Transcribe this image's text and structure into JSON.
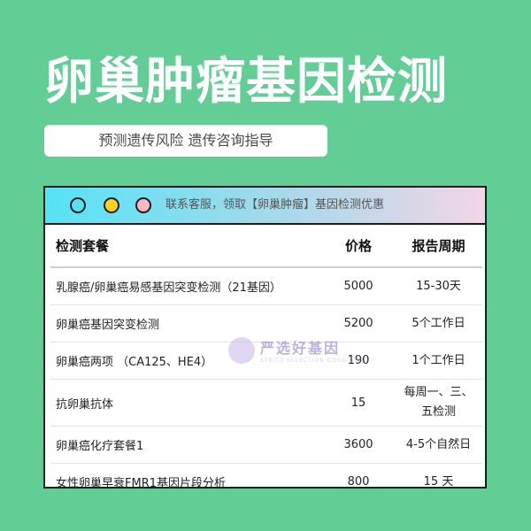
{
  "header": {
    "title": "卵巢肿瘤基因检测",
    "subtitle": "预测遗传风险 遗传咨询指导"
  },
  "window": {
    "bar_text": "联系客服，领取【卵巢肿瘤】基因检测优惠",
    "dots": [
      {
        "name": "blue-dot-icon",
        "color": "#59e0f0"
      },
      {
        "name": "yellow-dot-icon",
        "color": "#ffd21f"
      },
      {
        "name": "pink-dot-icon",
        "color": "#f8b8c2"
      }
    ]
  },
  "table": {
    "headers": [
      "检测套餐",
      "价格",
      "报告周期"
    ],
    "rows": [
      {
        "name": "乳腺癌/卵巢癌易感基因突变检测（21基因）",
        "price": "5000",
        "cycle": "15-30天"
      },
      {
        "name": "卵巢癌基因突变检测",
        "price": "5200",
        "cycle": "5个工作日"
      },
      {
        "name": "卵巢癌两项 （CA125、HE4）",
        "price": "190",
        "cycle": "1个工作日"
      },
      {
        "name": "抗卵巢抗体",
        "price": "15",
        "cycle": "每周一、三、五检测"
      },
      {
        "name": "卵巢癌化疗套餐1",
        "price": "3600",
        "cycle": "4-5个自然日"
      },
      {
        "name": "女性卵巢早衰FMR1基因片段分析",
        "price": "800",
        "cycle": "15 天"
      }
    ]
  },
  "watermark": {
    "main": "严选好基因",
    "sub": "STRICT SELECTION GOOD GENE"
  },
  "colors": {
    "background": "#62cd95",
    "bar_gradient_start": "#55e3f5",
    "bar_gradient_end": "#f3d6e6"
  }
}
